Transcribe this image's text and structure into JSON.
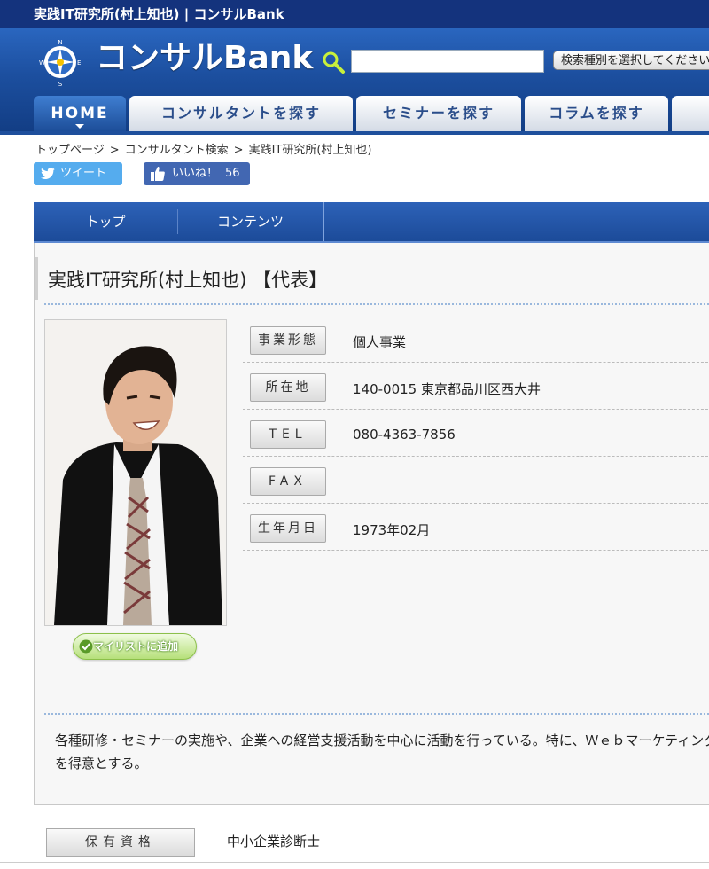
{
  "window": {
    "title": "実践IT研究所(村上知也) | コンサルBank"
  },
  "header": {
    "logo_text": "コンサルBank",
    "search_placeholder": "",
    "search_type_label": "検索種別を選択してください"
  },
  "nav": {
    "tabs": [
      {
        "label": "HOME",
        "active": true
      },
      {
        "label": "コンサルタントを探す"
      },
      {
        "label": "セミナーを探す"
      },
      {
        "label": "コラムを探す"
      }
    ]
  },
  "breadcrumb": {
    "items": [
      "トップページ",
      "コンサルタント検索",
      "実践IT研究所(村上知也)"
    ],
    "separator": ">"
  },
  "social": {
    "tweet_label": "ツイート",
    "like_label": "いいね！",
    "like_count": "56"
  },
  "subnav": {
    "tabs": [
      "トップ",
      "コンテンツ"
    ]
  },
  "profile": {
    "title": "実践IT研究所(村上知也) 【代表】",
    "mylist_label": "マイリストに追加",
    "fields": [
      {
        "label": "事業形態",
        "value": "個人事業"
      },
      {
        "label": "所在地",
        "value": "140-0015 東京都品川区西大井"
      },
      {
        "label": "TEL",
        "value": "080-4363-7856"
      },
      {
        "label": "FAX",
        "value": ""
      },
      {
        "label": "生年月日",
        "value": "1973年02月"
      }
    ],
    "description": "各種研修・セミナーの実施や、企業への経営支援活動を中心に活動を行っている。特に、Ｗｅｂマーケティングを得意とする。",
    "qualification_label": "保有資格",
    "qualification_value": "中小企業診断士"
  },
  "colors": {
    "brand_navy": "#14337d",
    "header_blue": "#1c4f9f",
    "twitter_blue": "#55acee",
    "facebook_blue": "#4267b2",
    "mylist_green": "#8cc04a"
  }
}
